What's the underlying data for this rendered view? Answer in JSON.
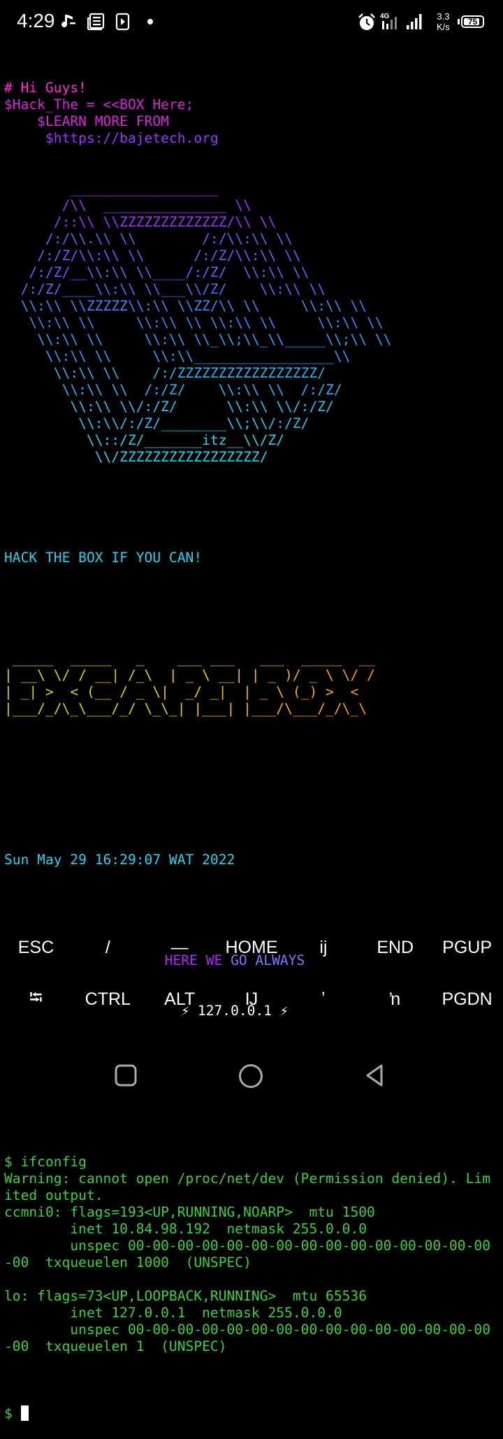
{
  "status_bar": {
    "time": "4:29",
    "network_type": "4G",
    "speed_value": "3.3",
    "speed_unit": "K/s",
    "battery_level": "75",
    "battery_fraction": 0.75,
    "icons": [
      "music-note-icon",
      "news-icon",
      "play-box-icon",
      "dot-icon",
      "alarm-icon",
      "data-signal-icon",
      "cell-signal-icon",
      "battery-icon"
    ]
  },
  "terminal": {
    "banner_lines": [
      {
        "text": "# Hi Guys!",
        "color": "pink"
      },
      {
        "text": "$Hack_The = <<BOX Here;",
        "color": "magenta"
      },
      {
        "text": "    $LEARN MORE FROM",
        "color": "magenta"
      },
      {
        "text": "     $https://bajetech.org",
        "color": "purple"
      }
    ],
    "ascii_art_lines": [
      {
        "text": "        __________________",
        "color": "purple"
      },
      {
        "text": "       /\\\\  _______________ \\\\",
        "color": "purple"
      },
      {
        "text": "      /::\\\\ \\\\ZZZZZZZZZZZZZ/\\\\ \\\\",
        "color": "purple"
      },
      {
        "text": "     /:/\\\\.\\\\ \\\\        /:/\\\\:\\\\ \\\\",
        "color": "blue1"
      },
      {
        "text": "    /:/Z/\\\\:\\\\ \\\\      /:/Z/\\\\:\\\\ \\\\",
        "color": "blue1"
      },
      {
        "text": "   /:/Z/__\\\\:\\\\ \\\\____/:/Z/  \\\\:\\\\ \\\\",
        "color": "blue2"
      },
      {
        "text": "  /:/Z/____\\\\:\\\\ \\\\___\\\\/Z/    \\\\:\\\\ \\\\",
        "color": "blue2"
      },
      {
        "text": "  \\\\:\\\\ \\\\ZZZZZ\\\\:\\\\ \\\\ZZ/\\\\ \\\\     \\\\:\\\\ \\\\",
        "color": "blue3"
      },
      {
        "text": "   \\\\:\\\\ \\\\     \\\\:\\\\ \\\\ \\\\:\\\\ \\\\     \\\\:\\\\ \\\\",
        "color": "blue3"
      },
      {
        "text": "    \\\\:\\\\ \\\\     \\\\:\\\\ \\\\_\\\\;\\\\_\\\\_____\\\\;\\\\ \\\\",
        "color": "blue4"
      },
      {
        "text": "     \\\\:\\\\ \\\\     \\\\:\\\\_________________\\\\",
        "color": "blue4"
      },
      {
        "text": "      \\\\:\\\\ \\\\    /:/ZZZZZZZZZZZZZZZZZ/",
        "color": "blue5"
      },
      {
        "text": "       \\\\:\\\\ \\\\  /:/Z/    \\\\:\\\\ \\\\  /:/Z/",
        "color": "blue5"
      },
      {
        "text": "        \\\\:\\\\ \\\\/:/Z/      \\\\:\\\\ \\\\/:/Z/",
        "color": "cyan1"
      },
      {
        "text": "         \\\\:\\\\/:/Z/________\\\\;\\\\/:/Z/",
        "color": "cyan1"
      },
      {
        "text": "          \\\\::/Z/_______itz__\\\\/Z/",
        "color": "cyan2"
      },
      {
        "text": "           \\\\/ZZZZZZZZZZZZZZZZZ/",
        "color": "cyan2"
      }
    ],
    "tagline": "HACK THE BOX IF YOU CAN!",
    "figlet_lines": [
      " _____  _____   _    ___ ___   ___  _____  __",
      "| __\\ \\/ / __| /_\\  | _ \\ __| | _ )/ _ \\ \\/ /",
      "| _| >  < (__ / _ \\|  _/ _|  | _ \\ (_) >  < ",
      "|___/_/\\_\\___/_/ \\_\\_| |___| |___/\\___/_/\\_\\"
    ],
    "date_line": "Sun May 29 16:29:07 WAT 2022",
    "motto": "HERE WE GO ALWAYS",
    "ip_line": "⚡ 127.0.0.1 ⚡",
    "output_lines": [
      "$ ifconfig",
      "Warning: cannot open /proc/net/dev (Permission denied). Lim",
      "ited output.",
      "ccmni0: flags=193<UP,RUNNING,NOARP>  mtu 1500",
      "        inet 10.84.98.192  netmask 255.0.0.0",
      "        unspec 00-00-00-00-00-00-00-00-00-00-00-00-00-00-00",
      "-00  txqueuelen 1000  (UNSPEC)",
      "",
      "lo: flags=73<UP,LOOPBACK,RUNNING>  mtu 65536",
      "        inet 127.0.0.1  netmask 255.0.0.0",
      "        unspec 00-00-00-00-00-00-00-00-00-00-00-00-00-00-00",
      "-00  txqueuelen 1  (UNSPEC)",
      ""
    ],
    "prompt": "$ "
  },
  "extra_keys": {
    "row1": [
      "ESC",
      "/",
      "—",
      "HOME",
      "ij",
      "END",
      "PGUP"
    ],
    "row2": [
      "⭾",
      "CTRL",
      "ALT",
      "Ĳ",
      "ʼ",
      "ŉ",
      "PGDN"
    ]
  },
  "colors": {
    "pink": "#ff2bd6",
    "magenta": "#d826d8",
    "purple": "#9b33ff",
    "blue1": "#6b5cff",
    "blue2": "#4f6dff",
    "blue3": "#3f86ff",
    "blue4": "#2f9dff",
    "blue5": "#27b4f5",
    "cyan1": "#22c7ee",
    "cyan2": "#1fd6e8",
    "green": "#3cd13c"
  }
}
